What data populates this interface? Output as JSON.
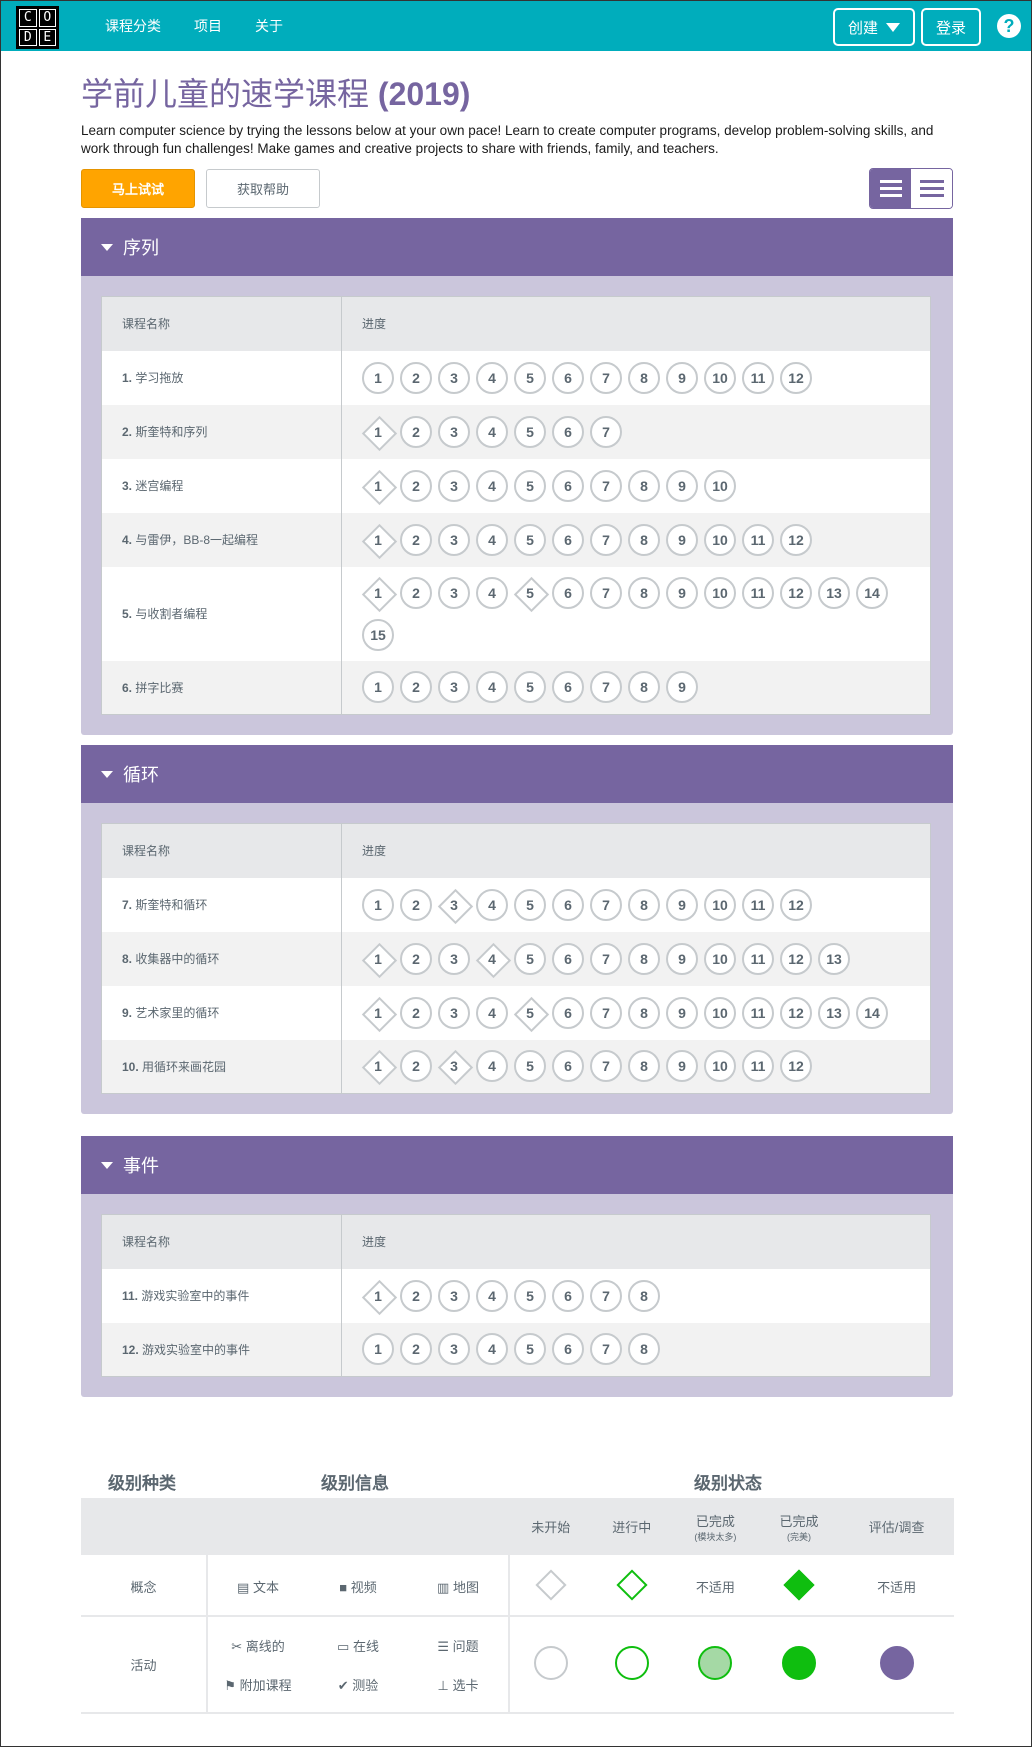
{
  "header": {
    "logo_letters": [
      "C",
      "O",
      "D",
      "E"
    ],
    "nav": [
      "课程分类",
      "项目",
      "关于"
    ],
    "create_label": "创建",
    "login_label": "登录",
    "help_glyph": "?"
  },
  "title": "学前儿童的速学课程",
  "title_year": "(2019)",
  "description": "Learn computer science by trying the lessons below at your own pace! Learn to create computer programs, develop problem-solving skills, and work through fun challenges! Make games and creative projects to share with friends, family, and teachers.",
  "try_now_label": "马上试试",
  "get_help_label": "获取帮助",
  "table_headers": {
    "name": "课程名称",
    "progress": "进度"
  },
  "sections": [
    {
      "title": "序列",
      "lessons": [
        {
          "num": "1.",
          "name": "学习拖放",
          "levels": 12,
          "diamonds": []
        },
        {
          "num": "2.",
          "name": "斯奎特和序列",
          "levels": 7,
          "diamonds": [
            1
          ]
        },
        {
          "num": "3.",
          "name": "迷宫编程",
          "levels": 10,
          "diamonds": [
            1
          ]
        },
        {
          "num": "4.",
          "name": "与雷伊，BB-8一起编程",
          "levels": 12,
          "diamonds": [
            1
          ]
        },
        {
          "num": "5.",
          "name": "与收割者编程",
          "levels": 15,
          "diamonds": [
            1,
            5
          ]
        },
        {
          "num": "6.",
          "name": "拼字比赛",
          "levels": 9,
          "diamonds": []
        }
      ]
    },
    {
      "title": "循环",
      "lessons": [
        {
          "num": "7.",
          "name": "斯奎特和循环",
          "levels": 12,
          "diamonds": [
            3
          ]
        },
        {
          "num": "8.",
          "name": "收集器中的循环",
          "levels": 13,
          "diamonds": [
            1,
            4
          ]
        },
        {
          "num": "9.",
          "name": "艺术家里的循环",
          "levels": 14,
          "diamonds": [
            1,
            5
          ]
        },
        {
          "num": "10.",
          "name": "用循环来画花园",
          "levels": 12,
          "diamonds": [
            1,
            3
          ]
        }
      ]
    },
    {
      "title": "事件",
      "lessons": [
        {
          "num": "11.",
          "name": "游戏实验室中的事件",
          "levels": 8,
          "diamonds": [
            1
          ]
        },
        {
          "num": "12.",
          "name": "游戏实验室中的事件",
          "levels": 8,
          "diamonds": []
        }
      ]
    }
  ],
  "key": {
    "title_type": "级别种类",
    "title_info": "级别信息",
    "title_status": "级别状态",
    "status_headers": [
      "未开始",
      "进行中",
      "已完成",
      "已完成",
      "评估/调查"
    ],
    "status_sub": [
      "",
      "",
      "(模块太多)",
      "(完美)",
      ""
    ],
    "concept_label": "概念",
    "activity_label": "活动",
    "concept_items": [
      "文本",
      "视频",
      "地图"
    ],
    "concept_icons": [
      "document-icon",
      "video-icon",
      "map-icon"
    ],
    "concept_status": [
      "",
      "",
      "不适用",
      "",
      "不适用"
    ],
    "activity_items": [
      "离线的",
      "在线",
      "问题",
      "附加课程",
      "测验",
      "选卡"
    ],
    "activity_icons": [
      "scissors-icon",
      "monitor-icon",
      "list-icon",
      "flag-icon",
      "check-icon",
      "sitemap-icon"
    ]
  }
}
